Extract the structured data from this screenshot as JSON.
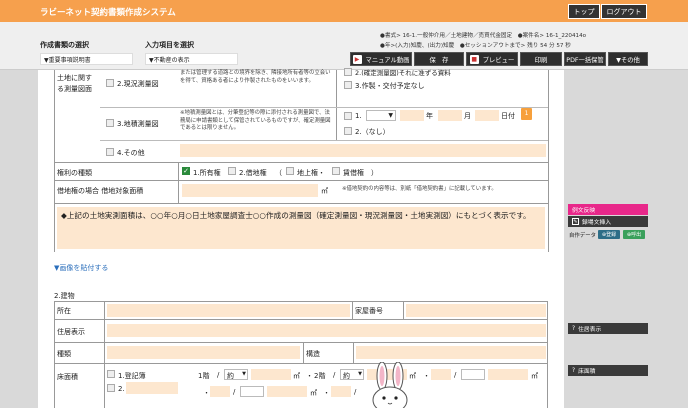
{
  "header": {
    "app_title": "ラビーネット契約書類作成システム",
    "top_button": "トップ",
    "logout_button": "ログアウト"
  },
  "toolbar": {
    "doc_type_label": "作成書類の選択",
    "doc_type_value": "▼重要事項説明書",
    "input_item_label": "入力項目を選択",
    "input_item_value": "▼不動産の表示",
    "info_line1": "●書式> 16-1.一般仲介用／土地建物／売買代金固定　●案件名> 16-1_220414o",
    "info_line2": "●年>(入力)知慶、(出力)知慶　●セッションアウトまで> 残り 54 分 57 秒",
    "manual_button": "マニュアル動画",
    "save_button": "保　存",
    "preview_button": "プレビュー",
    "print_button": "印刷",
    "pdf_button": "PDF一括保管",
    "other_button": "▼その他"
  },
  "land": {
    "row_label": "土地に関する測量図面",
    "item2_label": "2.現況測量図",
    "item2_note": "または管理する道路との境界を除き、隣接地所有者等の立会いを得て、資格ある者により作製されたものをいいます。",
    "item3_label": "3.地積測量図",
    "item3_note": "※地積測量図とは、分筆登記等の際に添付される測量図で、法務局に申請書類として保管されているものですが、確定測量図であるとは限りません。",
    "item4_label": "4.その他",
    "right_top": "2.(確定測量図)それに准ずる資料",
    "right_opt3": "3.作製・交付予定なし",
    "date_num1": "1.",
    "date_nen": "年",
    "date_tsuki": "月",
    "date_hizuke": "日付",
    "date_num2": "2.（なし）"
  },
  "rights": {
    "label": "権利の種類",
    "opt1": "1.所有権",
    "opt2": "2.借地権",
    "paren_open": "（",
    "sub1": "地上権・",
    "sub2": "賃借権",
    "paren_close": "）"
  },
  "leasehold": {
    "label": "借地権の場合 借地対象面積",
    "unit": "㎡",
    "note": "※借地契約の内容等は、別紙「借地契約書」に記載しています。"
  },
  "remark": "◆上記の土地実測面積は、○○年○月○日土地家屋調査士○○作成の測量図（確定測量図・現況測量図・土地実測図）にもとづく表示です。",
  "paste_link": "▼画像を貼付する",
  "building": {
    "section_title": "2.建物",
    "location_label": "所在",
    "house_no_label": "家屋番号",
    "residence_label": "住居表示",
    "kind_label": "種類",
    "structure_label": "構造",
    "floor_label": "床面積",
    "floor_opt1": "1.登記簿",
    "floor_opt2": "2.",
    "floor1": "1階",
    "floor2": "2階",
    "approx": "約",
    "unit": "㎡",
    "slash": "/",
    "dot": "・"
  },
  "sidebar": {
    "example_button": "例文反映",
    "insert_button": "録場文挿入",
    "user_data_label": "自作データ",
    "register_button": "登録",
    "call_button": "呼出",
    "residence_btn": "住居表示",
    "floor_btn": "床面積"
  }
}
